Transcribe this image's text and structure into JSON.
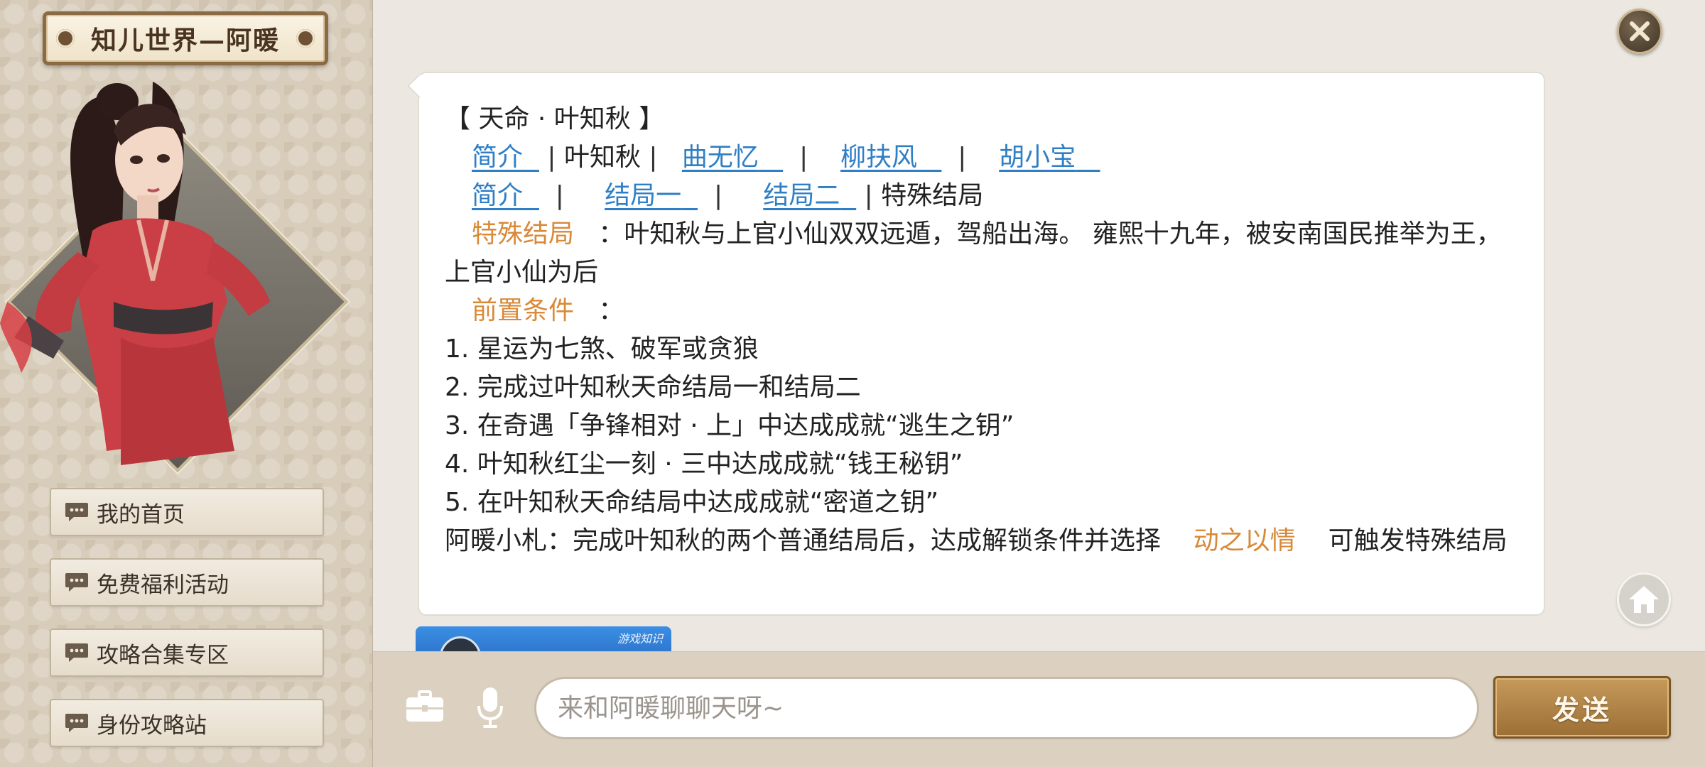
{
  "sidebar": {
    "title": "知儿世界—阿暖",
    "menu": [
      {
        "label": "我的首页",
        "icon": "chat-bubble-icon"
      },
      {
        "label": "免费福利活动",
        "icon": "chat-bubble-icon"
      },
      {
        "label": "攻略合集专区",
        "icon": "chat-bubble-icon"
      },
      {
        "label": "身份攻略站",
        "icon": "chat-bubble-icon"
      }
    ]
  },
  "message": {
    "heading": "【 天命 · 叶知秋 】",
    "nav1": {
      "link_intro": "简介",
      "current": "叶知秋",
      "link_a": "曲无忆",
      "link_b": "柳扶风",
      "link_c": "胡小宝"
    },
    "nav2": {
      "link_intro": "简介",
      "link_end1": "结局一",
      "link_end2": "结局二",
      "current": "特殊结局"
    },
    "special_label": "特殊结局",
    "special_text": "：叶知秋与上官小仙双双远遁，驾船出海。 雍熙十九年，被安南国民推举为王，上官小仙为后",
    "pre_label": "前置条件",
    "pre_colon": "：",
    "conditions": [
      "1. 星运为七煞、破军或贪狼",
      "2. 完成过叶知秋天命结局一和结局二",
      "3. 在奇遇「争锋相对 · 上」中达成成就“逃生之钥”",
      "4. 叶知秋红尘一刻 · 三中达成成就“钱王秘钥”",
      "5. 在叶知秋天命结局中达成成就“密道之钥”"
    ],
    "tip_prefix": "阿暖小札：完成叶知秋的两个普通结局后，达成解锁条件并选择",
    "tip_highlight": "动之以情",
    "tip_suffix": "可触发特殊结局"
  },
  "next_card": {
    "tag": "游戏知识"
  },
  "input": {
    "placeholder": "来和阿暖聊聊天呀~"
  },
  "send_label": "发送",
  "colors": {
    "link": "#2f7fc6",
    "highlight": "#d98938",
    "send_button": "#b0824a",
    "sidebar_bg": "#d8cdbb"
  }
}
